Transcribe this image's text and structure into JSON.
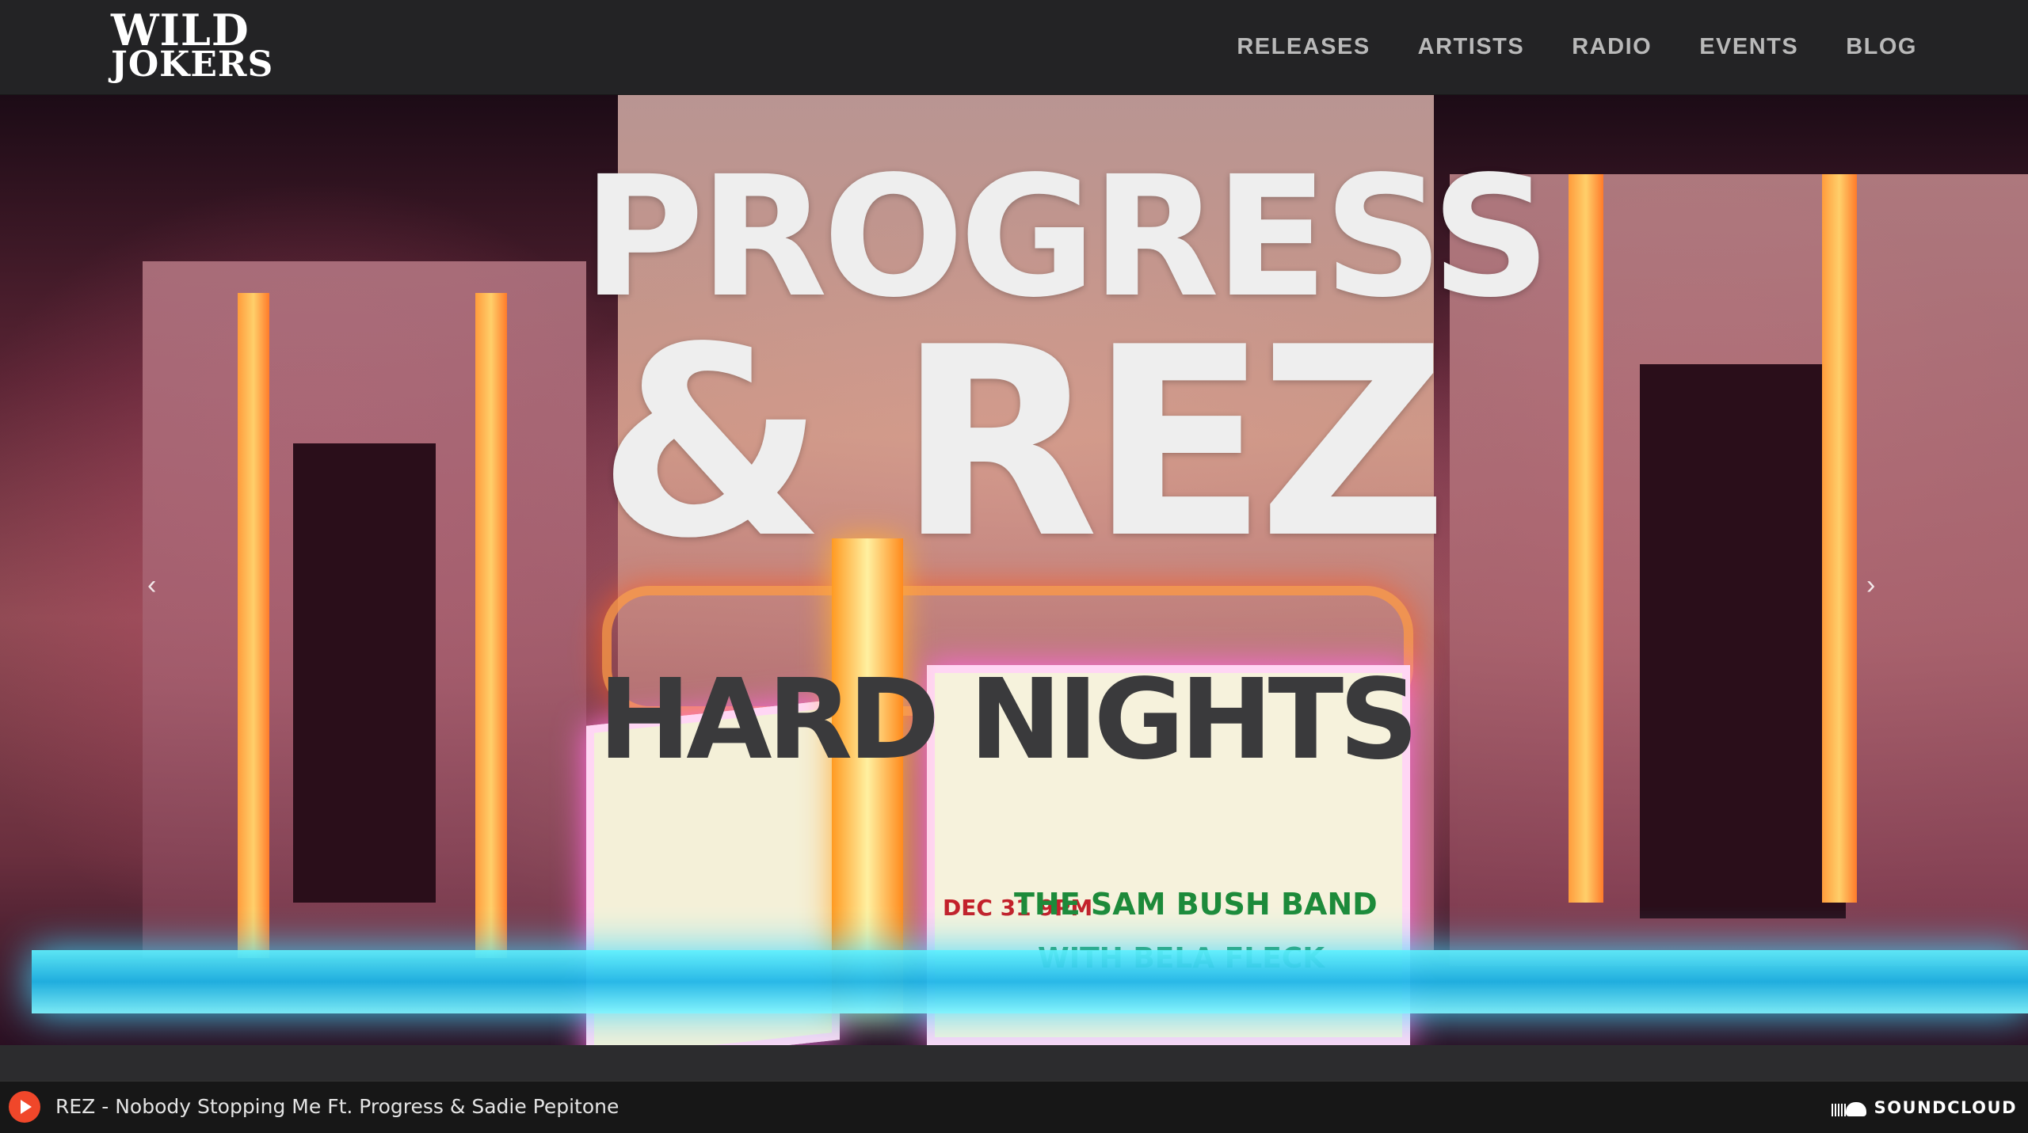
{
  "brand": {
    "logo_line1": "WILD",
    "logo_line2": "JOKERS"
  },
  "nav": {
    "items": [
      "RELEASES",
      "ARTISTS",
      "RADIO",
      "EVENTS",
      "BLOG"
    ]
  },
  "hero": {
    "title_line1": "PROGRESS",
    "title_line2": "& REZ",
    "subtitle": "HARD NIGHTS",
    "prev_arrow": "‹",
    "next_arrow": "›",
    "marquee": {
      "line1": "THE SAM BUSH BAND",
      "line2": "WITH BELA FLECK",
      "date": "DEC 31 9PM"
    }
  },
  "player": {
    "track_title": "REZ - Nobody Stopping Me Ft. Progress & Sadie Pepitone",
    "provider_label": "SOUNDCLOUD",
    "play_icon": "play-icon",
    "provider_icon": "soundcloud-icon"
  },
  "colors": {
    "header_bg": "#232325",
    "nav_text": "#b9b9b9",
    "player_bg": "#171717",
    "play_accent": "#f0472a"
  }
}
